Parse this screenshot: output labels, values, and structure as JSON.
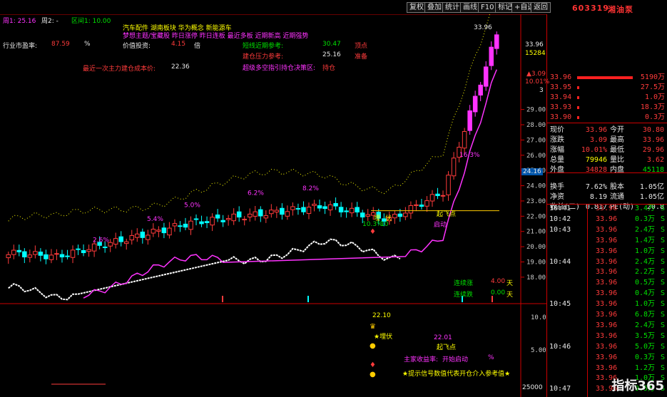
{
  "toolbar": {
    "tabs": [
      "复权",
      "叠加",
      "统计",
      "画线",
      "F10",
      "标记",
      "+自选",
      "返回"
    ],
    "stock_code": "603319",
    "stock_name": "湘油泵"
  },
  "legend": {
    "item1": "周1: 25.16",
    "item2": "周2: -",
    "item3": "区间1: 10.00"
  },
  "concepts": {
    "line1": "汽车配件      湖南板块      华为概念  新能源车",
    "line2": "梦想主题/宝藏股  昨日涨停  昨日连板  最近多板  近期新高  近期强势"
  },
  "info": {
    "industry_label": "行业市盈率:",
    "industry_value": "87.59",
    "industry_unit": "%",
    "value_label": "价值投资:",
    "value_value": "4.15",
    "value_unit": "倍",
    "funds_label": "最近一次主力建仓成本价:",
    "funds_value": "22.36",
    "support_label": "短线近期参考:",
    "support_value": "30.47",
    "support_tag": "顶点",
    "resist_label": "建仓压力参考:",
    "resist_value": "25.16",
    "resist_tag": "准备",
    "signal_label": "超级多空指引持仓决策区:",
    "signal_tag": "持仓"
  },
  "chart_data": {
    "type": "candlestick",
    "y_ticks": [
      29.0,
      28.0,
      27.0,
      26.0,
      25.0,
      24.0,
      23.0,
      22.0,
      21.0,
      20.0,
      19.0,
      18.0
    ],
    "ylim": [
      17.2,
      34.5
    ],
    "price_top_label": "33.96",
    "right_box_value": "24.16",
    "annotations": [
      {
        "text": "2.6%",
        "value": 20.3
      },
      {
        "text": "5.4%",
        "value": 21.7
      },
      {
        "text": "5.0%",
        "value": 22.6
      },
      {
        "text": "6.2%",
        "value": 23.4
      },
      {
        "text": "8.2%",
        "value": 23.7
      },
      {
        "text": "16.3%",
        "value": 25.9
      }
    ],
    "markers": {
      "bury": "埋",
      "ambush": "伏",
      "take_off": "起飞点",
      "start": "启动",
      "pct": "10.3%",
      "val": "10"
    },
    "streak": {
      "up_label": "连续涨",
      "up_value": "4.00",
      "up_unit": "天",
      "down_label": "连续跌",
      "down_value": "0.00",
      "down_unit": "天"
    },
    "sub": {
      "y_ticks": [
        "10.00",
        "5.00"
      ],
      "val1": "22.10",
      "val2": "22.01",
      "ambush_label": "★埋伏",
      "takeoff_label": "起飞点",
      "main_profit": "主家收益率:",
      "main_profit_tag": "开始启动",
      "main_profit_unit": "%",
      "hint": "★提示信号数值代表开仓介入参考值★",
      "bottom_tick": "25000"
    }
  },
  "side_top": {
    "top_price": "33.96",
    "vol": "15284",
    "chg": "▲3.09",
    "pct": "10.01%",
    "n": "3"
  },
  "orderbook": [
    {
      "price": "33.96",
      "vol": "5190万",
      "bar": 1.0
    },
    {
      "price": "33.95",
      "vol": "27.5万",
      "bar": 0
    },
    {
      "price": "33.94",
      "vol": "1.0万",
      "bar": 0
    },
    {
      "price": "33.93",
      "vol": "18.3万",
      "bar": 0
    },
    {
      "price": "33.90",
      "vol": "0.3万",
      "bar": 0
    }
  ],
  "stats": [
    {
      "k1": "现价",
      "v1": "33.96",
      "k2": "今开",
      "v2": "30.80",
      "c1": "red",
      "c2": "red"
    },
    {
      "k1": "涨跌",
      "v1": "3.09",
      "k2": "最高",
      "v2": "33.96",
      "c1": "red",
      "c2": "red"
    },
    {
      "k1": "涨幅",
      "v1": "10.01%",
      "k2": "最低",
      "v2": "29.96",
      "c1": "red",
      "c2": "red"
    },
    {
      "k1": "总量",
      "v1": "79946",
      "k2": "量比",
      "v2": "3.62",
      "c1": "yellow",
      "c2": "red"
    },
    {
      "k1": "外盘",
      "v1": "34828",
      "k2": "内盘",
      "v2": "45118",
      "c1": "red",
      "c2": "green"
    },
    {
      "k1": "换手",
      "v1": "7.62%",
      "k2": "股本",
      "v2": "1.05亿",
      "c1": "white",
      "c2": "white"
    },
    {
      "k1": "净资",
      "v1": "8.19",
      "k2": "流通",
      "v2": "1.05亿",
      "c1": "white",
      "c2": "white"
    },
    {
      "k1": "收益(二)",
      "v1": "0.817",
      "k2": "PE(动)",
      "v2": "20.8",
      "c1": "white",
      "c2": "white"
    }
  ],
  "ticks": [
    {
      "t": "10:41",
      "p": "33.96",
      "v": "3.4万",
      "s": "S"
    },
    {
      "t": "10:42",
      "p": "33.96",
      "v": "0.3万",
      "s": "S"
    },
    {
      "t": "10:43",
      "p": "33.96",
      "v": "2.4万",
      "s": "S"
    },
    {
      "t": "",
      "p": "33.96",
      "v": "1.4万",
      "s": "S"
    },
    {
      "t": "",
      "p": "33.96",
      "v": "1.0万",
      "s": "S"
    },
    {
      "t": "10:44",
      "p": "33.96",
      "v": "2.4万",
      "s": "S"
    },
    {
      "t": "",
      "p": "33.96",
      "v": "2.2万",
      "s": "S"
    },
    {
      "t": "",
      "p": "33.96",
      "v": "0.5万",
      "s": "S"
    },
    {
      "t": "",
      "p": "33.96",
      "v": "0.4万",
      "s": "S"
    },
    {
      "t": "10:45",
      "p": "33.96",
      "v": "1.0万",
      "s": "S"
    },
    {
      "t": "",
      "p": "33.96",
      "v": "6.8万",
      "s": "S"
    },
    {
      "t": "",
      "p": "33.96",
      "v": "2.4万",
      "s": "S"
    },
    {
      "t": "",
      "p": "33.96",
      "v": "3.5万",
      "s": "S"
    },
    {
      "t": "10:46",
      "p": "33.96",
      "v": "5.0万",
      "s": "S"
    },
    {
      "t": "",
      "p": "33.96",
      "v": "0.3万",
      "s": "S"
    },
    {
      "t": "",
      "p": "33.96",
      "v": "1.2万",
      "s": "S"
    },
    {
      "t": "",
      "p": "33.96",
      "v": "1.0万",
      "s": "S"
    },
    {
      "t": "10:47",
      "p": "33.96",
      "v": "9.5万",
      "s": "S"
    }
  ],
  "watermark": "指标365"
}
